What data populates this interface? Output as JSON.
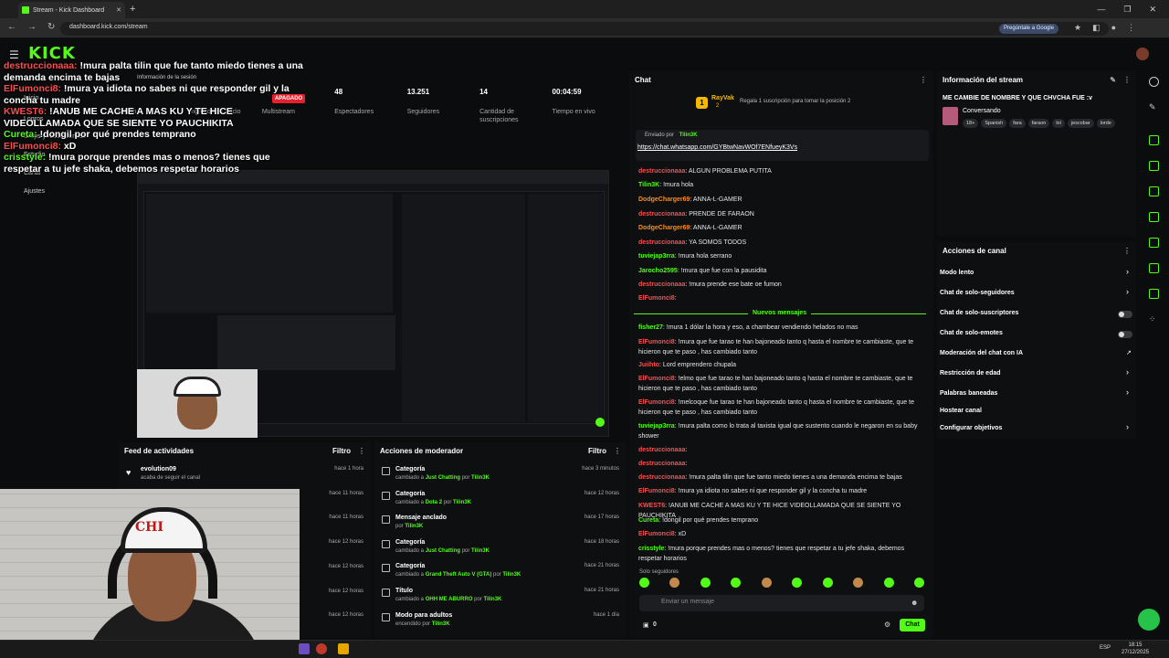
{
  "browser": {
    "tab_title": "Stream - Kick Dashboard",
    "url": "dashboard.kick.com/stream",
    "ask_google": "Pregúntale a Google",
    "new_tab": "+",
    "tab_close": "✕"
  },
  "kick": {
    "logo": "KICK"
  },
  "session": {
    "info_label": "Información de la sesión",
    "badge": "APAGADO",
    "stats": [
      {
        "value": "",
        "label": "Sesión"
      },
      {
        "value": "",
        "label": "Ingresos de Socio"
      },
      {
        "value": "",
        "label": "Multistream"
      },
      {
        "value": "48",
        "label": "Espectadores"
      },
      {
        "value": "13.251",
        "label": "Seguidores"
      },
      {
        "value": "14",
        "label": "Cantidad de suscripciones"
      },
      {
        "value": "00:04:59",
        "label": "Tiempo en vivo"
      }
    ]
  },
  "sidebar": {
    "items": [
      "Inicio",
      "Logros",
      "Drops y recompensas",
      "Canal",
      "Estudio",
      "Ajustes"
    ]
  },
  "overlay_chat": [
    {
      "user": "destruccionaaa:",
      "msg": " !mura palta tilin que fue tanto miedo tienes a una demanda encima te bajas",
      "c": "u"
    },
    {
      "user": "ElFumonci8:",
      "msg": " !mura ya idiota no sabes ni que responder gil y la concha tu madre",
      "c": "u"
    },
    {
      "user": "KWEST6:",
      "msg": " !ANUB ME CACHE A MAS KU Y TE HICE VIDEOLLAMADA QUE SE SIENTE YO PAUCHIKITA",
      "c": "u"
    },
    {
      "user": "Cureta:",
      "msg": " !dongil por qué prendes temprano",
      "c": "g"
    },
    {
      "user": "ElFumonci8:",
      "msg": " xD",
      "c": "u"
    },
    {
      "user": "crisstyle:",
      "msg": " !mura porque prendes mas o menos? tienes que respetar a tu jefe shaka, debemos respetar horarios",
      "c": "g"
    }
  ],
  "feed": {
    "title": "Feed de actividades",
    "filter": "Filtro",
    "items": [
      {
        "name": "evolution09",
        "sub": "acaba de seguir el canal",
        "time": "hace 1 hora"
      },
      {
        "name": "",
        "sub": "",
        "time": "hace 11 horas"
      },
      {
        "name": "",
        "sub": "",
        "time": "hace 11 horas"
      },
      {
        "name": "",
        "sub": "",
        "time": "hace 12 horas"
      },
      {
        "name": "",
        "sub": "",
        "time": "hace 12 horas"
      },
      {
        "name": "",
        "sub": "",
        "time": "hace 12 horas"
      },
      {
        "name": "",
        "sub": "",
        "time": "hace 12 horas"
      }
    ]
  },
  "mod": {
    "title": "Acciones de moderador",
    "filter": "Filtro",
    "items": [
      {
        "name": "Categoría",
        "pre": "cambiado a ",
        "val": "Just Chatting",
        "by": " por ",
        "who": "Tilin3K",
        "time": "hace 3 minutos"
      },
      {
        "name": "Categoría",
        "pre": "cambiado a ",
        "val": "Dota 2",
        "by": " por ",
        "who": "Tilin3K",
        "time": "hace 12 horas"
      },
      {
        "name": "Mensaje anclado",
        "pre": "",
        "val": "",
        "by": "por ",
        "who": "Tilin3K",
        "time": "hace 17 horas"
      },
      {
        "name": "Categoría",
        "pre": "cambiado a ",
        "val": "Just Chatting",
        "by": " por ",
        "who": "Tilin3K",
        "time": "hace 18 horas"
      },
      {
        "name": "Categoría",
        "pre": "cambiado a ",
        "val": "Grand Theft Auto V (GTA)",
        "by": " por ",
        "who": "Tilin3K",
        "time": "hace 21 horas"
      },
      {
        "name": "Título",
        "pre": "cambiado a ",
        "val": "OHH ME ABURRO",
        "by": " por ",
        "who": "Tilin3K",
        "time": "hace 21 horas"
      },
      {
        "name": "Modo para adultos",
        "pre": "encendido ",
        "val": "",
        "by": "por ",
        "who": "Tilin3K",
        "time": "hace 1 día"
      }
    ]
  },
  "chat": {
    "title": "Chat",
    "gift_user": "RayVak",
    "gift_count": "2",
    "gift_text": "Regala 1 suscripción para tomar la posición 2",
    "pinned_by": "Enviado por",
    "pinned_user": "Tilin3K",
    "pinned_link": "https://chat.whatsapp.com/GYBtwNavWOf7ENfueyK3Vs",
    "new_messages": "Nuevos mensajes",
    "followers_only": "Solo seguidores",
    "input_placeholder": "Enviar un mensaje",
    "send": "Chat",
    "count": "0",
    "messages": [
      {
        "user": "destruccionaaa",
        "msg": ": ALGUN PROBLEMA PUTITA",
        "color": "#ff4d4d"
      },
      {
        "user": "Tilin3K",
        "msg": ": !mura hola",
        "color": "#53fc18"
      },
      {
        "user": "DodgeCharger69",
        "msg": ": ANNA-L-GAMER",
        "color": "#ff8c1a"
      },
      {
        "user": "destruccionaaa",
        "msg": ": PRENDE DE FARAON",
        "color": "#ff4d4d"
      },
      {
        "user": "DodgeCharger69",
        "msg": ": ANNA-L-GAMER",
        "color": "#ff8c1a"
      },
      {
        "user": "destruccionaaa",
        "msg": ": YA SOMOS TODOS",
        "color": "#ff4d4d"
      },
      {
        "user": "tuviejap3rra",
        "msg": ": !mura hola serrano",
        "color": "#53fc18"
      },
      {
        "user": "Jarocho2595",
        "msg": ": !mura que fue con la pausidita",
        "color": "#53fc18"
      },
      {
        "user": "destruccionaaa",
        "msg": ": !mura prende ese bate oe fumon",
        "color": "#ff4d4d"
      },
      {
        "user": "ElFumonci8",
        "msg": ":",
        "color": "#ff4d4d"
      },
      {
        "user": "fisher27",
        "msg": ": !mura 1 dólar la hora y eso, a chambear vendiendo helados no mas",
        "color": "#53fc18"
      },
      {
        "user": "ElFumonci8",
        "msg": ": !mura que fue tarao te han bajoneado tanto q hasta el nombre te cambiaste, que te hicieron que te paso , has cambiado tanto",
        "color": "#ff4d4d"
      },
      {
        "user": "Juiihto",
        "msg": ": Lord emprendero chupala",
        "color": "#ff4d4d"
      },
      {
        "user": "ElFumonci8",
        "msg": ": !elmo que fue tarao te han bajoneado tanto q hasta el nombre te cambiaste, que te hicieron que te paso , has cambiado tanto",
        "color": "#ff4d4d"
      },
      {
        "user": "ElFumonci8",
        "msg": ": !melcoque fue tarao te han bajoneado tanto q hasta el nombre te cambiaste, que te hicieron que te paso , has cambiado tanto",
        "color": "#ff4d4d"
      },
      {
        "user": "tuviejap3rra",
        "msg": ": !mura palta como lo trata al taxista igual que sustento cuando le negaron en su baby shower",
        "color": "#53fc18"
      },
      {
        "user": "destruccionaaa",
        "msg": ":",
        "color": "#ff4d4d"
      },
      {
        "user": "destruccionaaa",
        "msg": ":",
        "color": "#ff4d4d"
      },
      {
        "user": "destruccionaaa",
        "msg": ": !mura palta tilin que fue tanto miedo tienes a una demanda encima te bajas",
        "color": "#ff4d4d"
      },
      {
        "user": "ElFumonci8",
        "msg": ": !mura ya idiota no sabes ni que responder gil y la concha tu madre",
        "color": "#ff4d4d"
      },
      {
        "user": "KWEST6",
        "msg": ": !ANUB ME CACHE A MAS KU Y TE HICE VIDEOLLAMADA QUE SE SIENTE YO PAUCHIKITA",
        "color": "#ff4d4d"
      },
      {
        "user": "Cureta",
        "msg": ": !dongil por qué prendes temprano",
        "color": "#53fc18"
      },
      {
        "user": "ElFumonci8",
        "msg": ": xD",
        "color": "#ff4d4d"
      },
      {
        "user": "crisstyle",
        "msg": ": !mura porque prendes mas o menos? tienes que respetar a tu jefe shaka, debemos respetar horarios",
        "color": "#53fc18"
      }
    ]
  },
  "stream_info": {
    "title": "Información del stream",
    "stream_title": "ME CAMBIE DE NOMBRE Y QUE CHVCHA FUE :v",
    "category": "Conversando",
    "tags": [
      "18+",
      "Spanish",
      "fara",
      "faraon",
      "lol",
      "jescobar",
      "lorde"
    ]
  },
  "channel_actions": {
    "title": "Acciones de canal",
    "items": [
      {
        "label": "Modo lento",
        "kind": "chev"
      },
      {
        "label": "Chat de solo-seguidores",
        "kind": "chev"
      },
      {
        "label": "Chat de solo-suscriptores",
        "kind": "toggle"
      },
      {
        "label": "Chat de solo-emotes",
        "kind": "toggle"
      },
      {
        "label": "Moderación del chat con IA",
        "kind": "ext"
      },
      {
        "label": "Restricción de edad",
        "kind": "chev"
      },
      {
        "label": "Palabras baneadas",
        "kind": "chev"
      },
      {
        "label": "Hostear canal",
        "kind": "none"
      },
      {
        "label": "Configurar objetivos",
        "kind": "chev"
      }
    ]
  },
  "taskbar": {
    "lang": "ESP",
    "time": "18:15",
    "date": "27/12/2025"
  },
  "colors": {
    "accent": "#53fc18",
    "danger": "#e8202e"
  }
}
